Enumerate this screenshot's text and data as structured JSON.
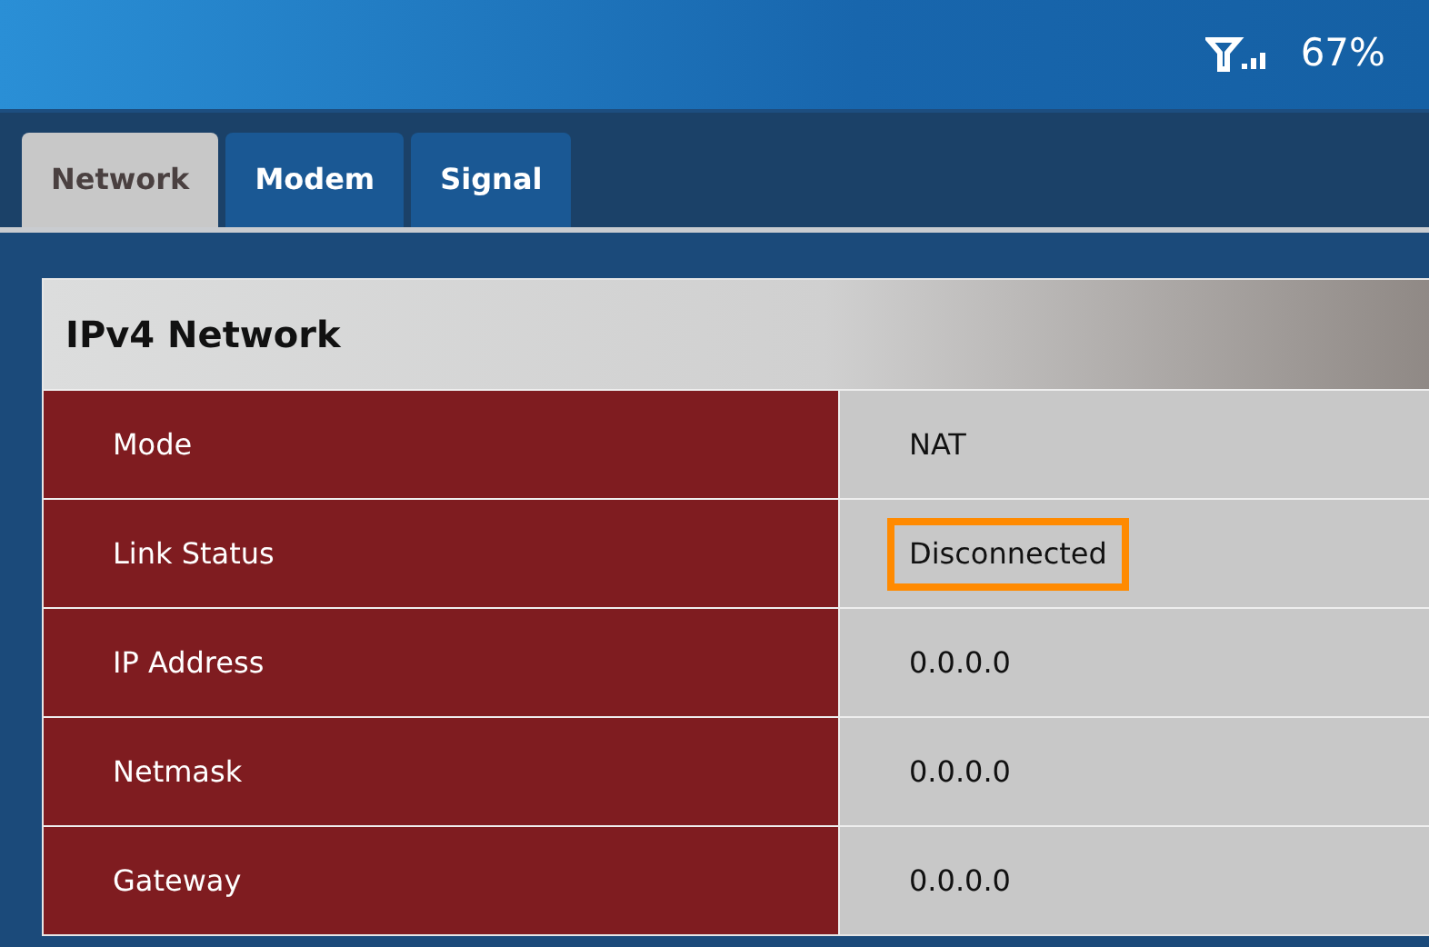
{
  "status": {
    "battery": "67%"
  },
  "tabs": [
    {
      "label": "Network",
      "selected": true
    },
    {
      "label": "Modem",
      "selected": false
    },
    {
      "label": "Signal",
      "selected": false
    }
  ],
  "panel": {
    "title": "IPv4 Network",
    "rows": [
      {
        "label": "Mode",
        "value": "NAT",
        "highlighted": false
      },
      {
        "label": "Link Status",
        "value": "Disconnected",
        "highlighted": true
      },
      {
        "label": "IP Address",
        "value": "0.0.0.0",
        "highlighted": false
      },
      {
        "label": "Netmask",
        "value": "0.0.0.0",
        "highlighted": false
      },
      {
        "label": "Gateway",
        "value": "0.0.0.0",
        "highlighted": false
      }
    ]
  }
}
